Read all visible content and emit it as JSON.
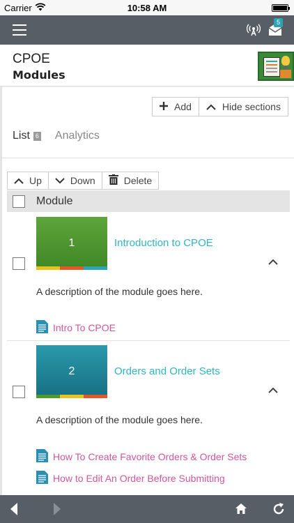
{
  "status_bar": {
    "carrier": "Carrier",
    "time": "10:58 AM"
  },
  "app_bar": {
    "inbox_count": "5"
  },
  "header": {
    "course_title": "CPOE",
    "page_title": "Modules"
  },
  "actions": {
    "add_label": "Add",
    "hide_sections_label": "Hide sections"
  },
  "tabs": [
    {
      "label": "List",
      "count": "6",
      "active": true
    },
    {
      "label": "Analytics",
      "active": false
    }
  ],
  "toolbar": {
    "up_label": "Up",
    "down_label": "Down",
    "delete_label": "Delete"
  },
  "table": {
    "header": "Module"
  },
  "modules": [
    {
      "number": "1",
      "title": "Introduction to CPOE",
      "description": "A description of the module goes here.",
      "thumb_color": "#4e9a2f",
      "items": [
        "Intro To CPOE"
      ]
    },
    {
      "number": "2",
      "title": "Orders and Order Sets",
      "description": "A description of the module goes here.",
      "thumb_color": "#1f8fa0",
      "items": [
        "How To Create Favorite Orders & Order Sets",
        "How to Edit An Order Before Submitting"
      ]
    }
  ],
  "colors": {
    "app_bar": "#585e65",
    "link_teal": "#2eb6c3",
    "item_pink": "#d1569a"
  }
}
